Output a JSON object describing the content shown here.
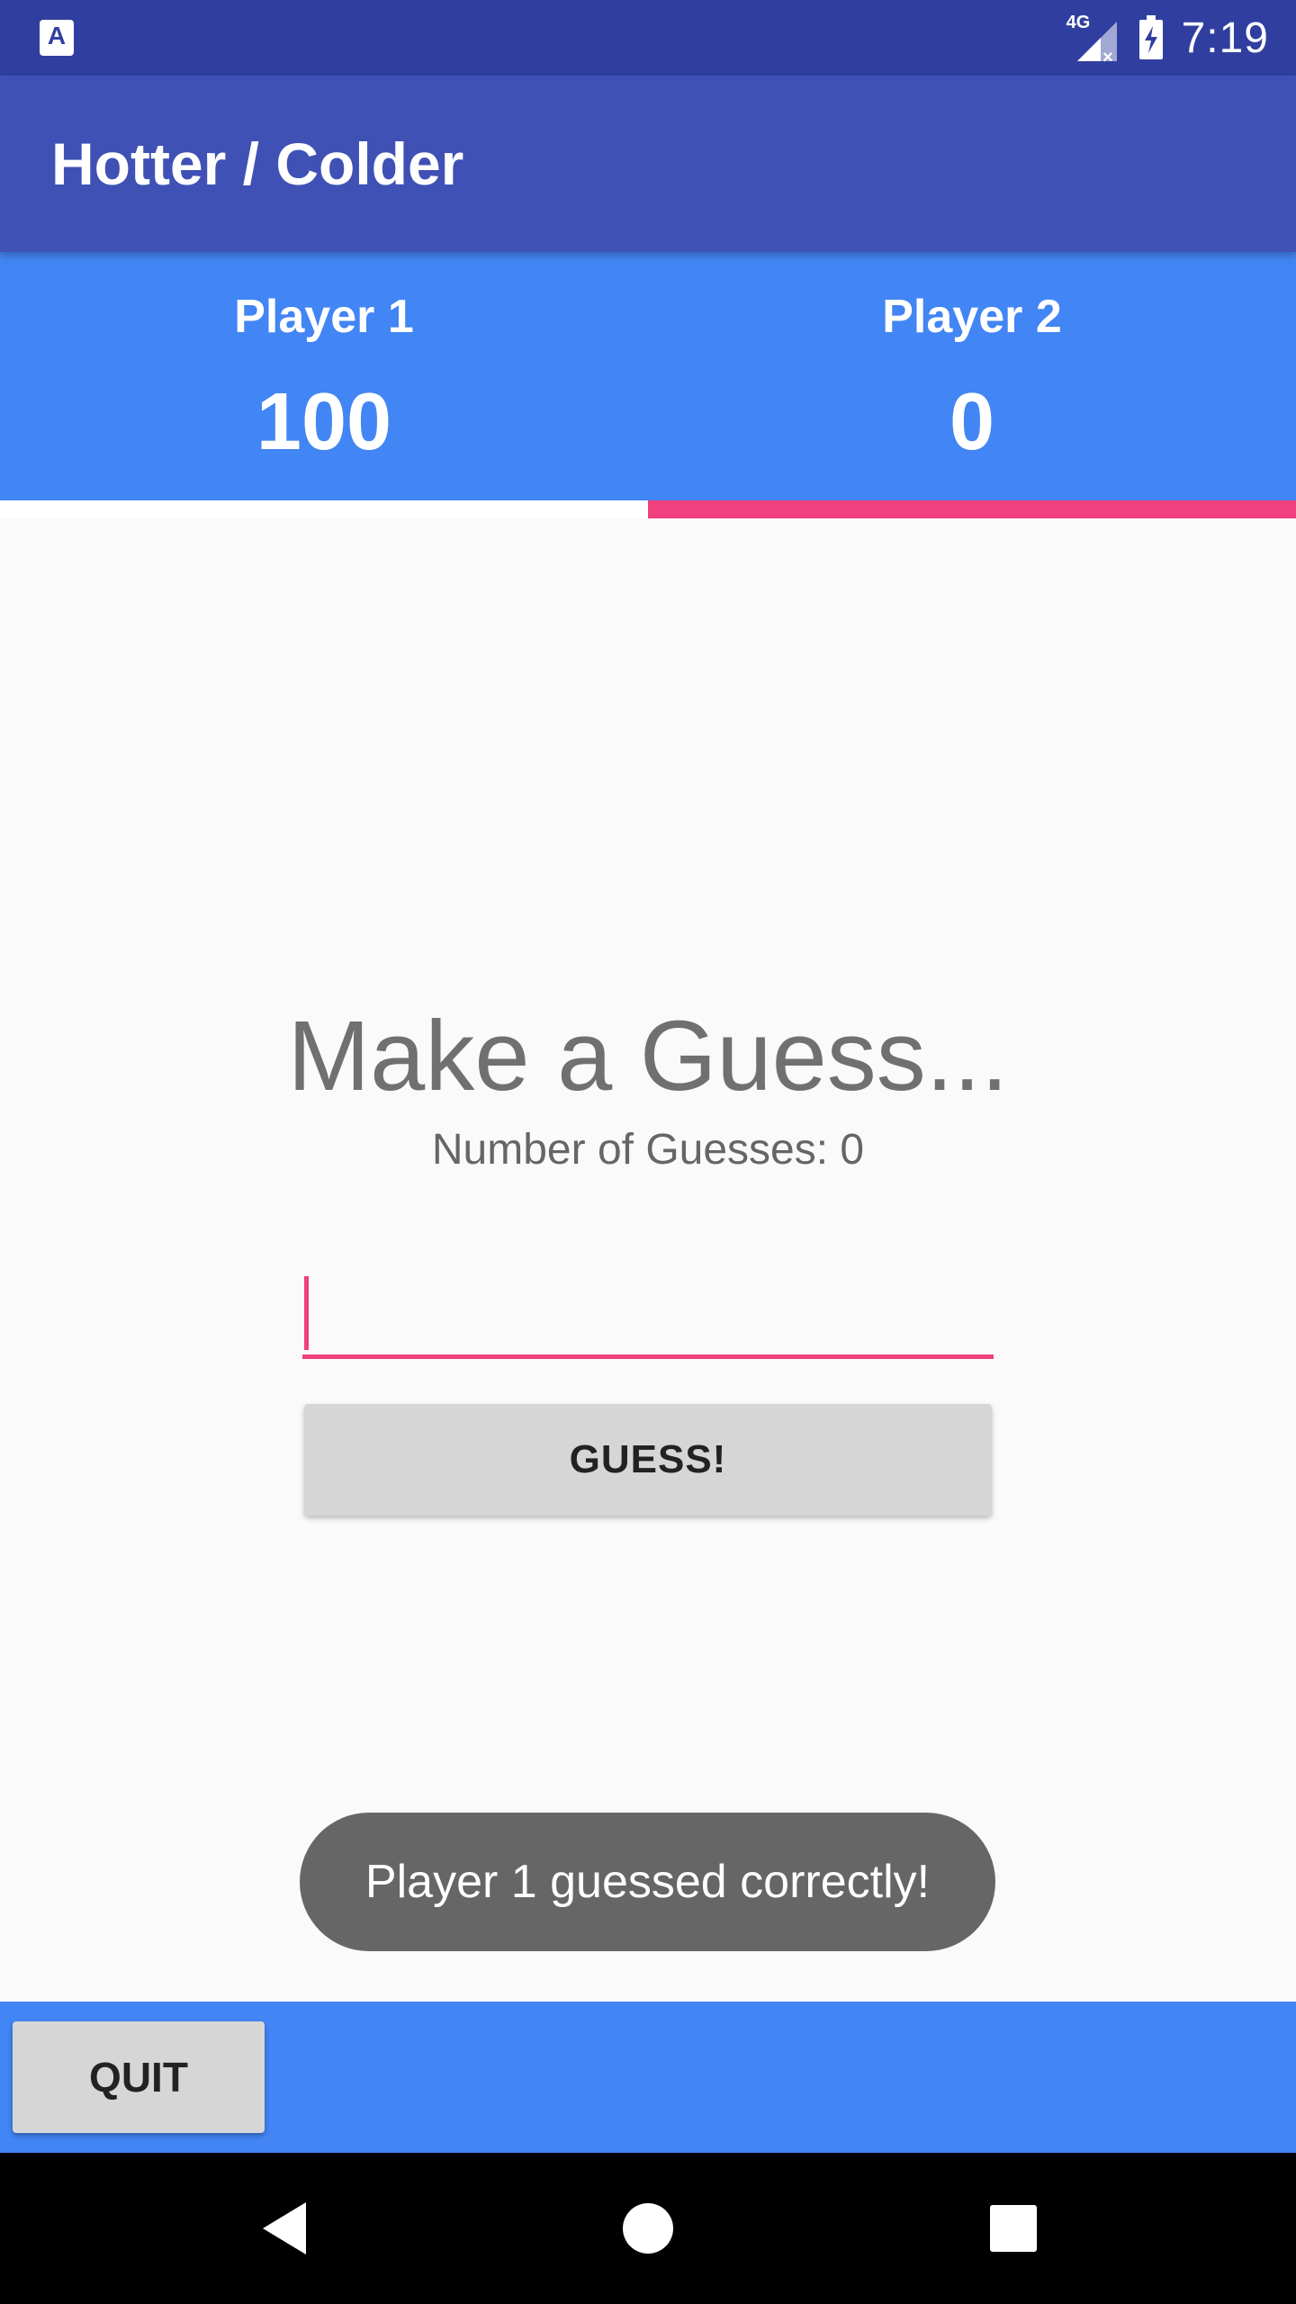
{
  "status_bar": {
    "time": "7:19",
    "network": "4G",
    "app_icon_letter": "A",
    "icons": [
      "app-notification-icon",
      "signal-icon",
      "battery-icon"
    ]
  },
  "app_bar": {
    "title": "Hotter / Colder"
  },
  "scoreboard": {
    "player1": {
      "name": "Player 1",
      "score": "100"
    },
    "player2": {
      "name": "Player 2",
      "score": "0"
    },
    "active_player": "Player 2"
  },
  "main": {
    "prompt": "Make a Guess...",
    "guess_count": "Number of Guesses: 0",
    "input": {
      "value": "",
      "placeholder": ""
    },
    "guess_button_label": "GUESS!"
  },
  "toast": {
    "message": "Player 1 guessed correctly!"
  },
  "bottom_bar": {
    "quit_label": "QUIT"
  },
  "nav_bar": {
    "icons": [
      "back-icon",
      "home-icon",
      "recents-icon"
    ]
  },
  "colors": {
    "status_bar": "#303f9f",
    "app_bar": "#3f51b5",
    "scoreboard": "#4285f4",
    "accent": "#f1407e",
    "button": "#d6d6d6",
    "toast": "#666666"
  }
}
